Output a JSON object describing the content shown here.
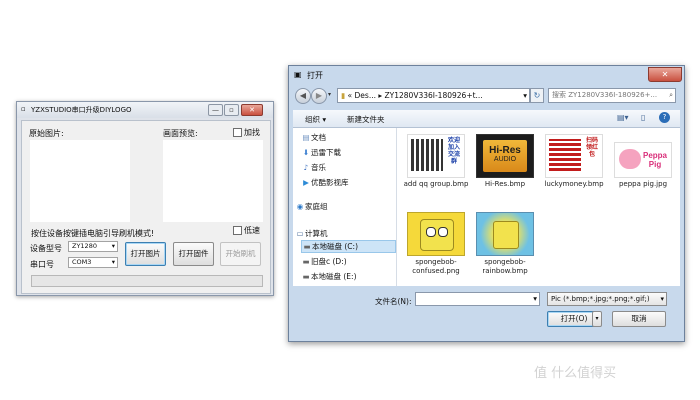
{
  "app": {
    "title": "YZXSTUDIO串口升级DIYLOGO",
    "original_label": "原始图片:",
    "preview_label": "画面预览:",
    "enlarge_label": "加找",
    "instruction": "按住设备按键插电脑引导刷机模式!",
    "lowspeed_label": "低速",
    "model_label": "设备型号",
    "model_value": "ZY1280",
    "port_label": "串口号",
    "port_value": "COM3",
    "open_image_button": "打开图片",
    "open_firmware_button": "打开固件",
    "start_flash_button": "开始刷机"
  },
  "dialog": {
    "title": "打开",
    "path": {
      "prefix": "«",
      "seg1": "Des...",
      "seg2": "ZY1280V336I-180926+t...",
      "search_placeholder": "搜索 ZY1280V336I-180926+..."
    },
    "toolbar": {
      "organize": "组织 ▾",
      "new_folder": "新建文件夹"
    },
    "nav": [
      {
        "label": "文档",
        "icon": "document-icon"
      },
      {
        "label": "迅雷下载",
        "icon": "download-icon"
      },
      {
        "label": "音乐",
        "icon": "music-icon"
      },
      {
        "label": "优酷影视库",
        "icon": "video-icon"
      },
      {
        "label": "家庭组",
        "icon": "homegroup-icon"
      },
      {
        "label": "计算机",
        "icon": "computer-icon"
      },
      {
        "label": "本地磁盘 (C:)",
        "icon": "drive-icon"
      },
      {
        "label": "旧盘c (D:)",
        "icon": "drive-icon"
      },
      {
        "label": "本地磁盘 (E:)",
        "icon": "drive-icon"
      }
    ],
    "files": [
      {
        "name": "add qq group.bmp",
        "thumb_text": "欢迎加入交流群"
      },
      {
        "name": "Hi-Res.bmp",
        "thumb_text": "Hi-Res",
        "thumb_sub": "AUDIO"
      },
      {
        "name": "luckymoney.bmp",
        "thumb_text": "扫码领红包"
      },
      {
        "name": "peppa pig.jpg",
        "thumb_text": "Peppa Pig"
      },
      {
        "name": "spongebob-confused.png",
        "thumb_text": ""
      },
      {
        "name": "spongebob-rainbow.bmp",
        "thumb_text": ""
      }
    ],
    "filename_label": "文件名(N):",
    "filename_value": "",
    "filter_value": "Pic (*.bmp;*.jpg;*.png;*.gif;)",
    "open_button": "打开(O)",
    "cancel_button": "取消"
  },
  "watermark": "值 什么值得买"
}
